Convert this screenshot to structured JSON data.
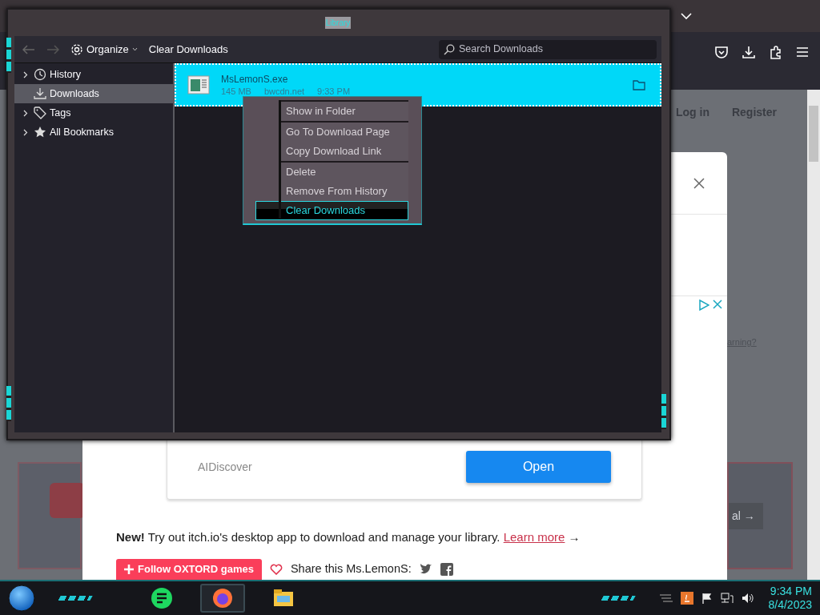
{
  "browser": {
    "nav_links": [
      "Log in",
      "Register"
    ]
  },
  "page": {
    "cut_link": "arning?",
    "side_button": "al →",
    "modal": {
      "ad_brand": "AIDiscover",
      "ad_button": "Open"
    },
    "notice": "**New!** Try out itch.io's desktop app to download and manage your library.",
    "notice_link": "Learn more",
    "notice_arrow": "→",
    "follow_button": "Follow OXTORD games",
    "share_label": "Share this Ms.LemonS:"
  },
  "library": {
    "title": "Library",
    "toolbar": {
      "organize": "Organize",
      "clear": "Clear Downloads",
      "search": {
        "placeholder": "Search Downloads"
      }
    },
    "sidebar": [
      {
        "label": "History",
        "kind": "history",
        "expandable": true,
        "selected": false
      },
      {
        "label": "Downloads",
        "kind": "downloads",
        "expandable": false,
        "selected": true
      },
      {
        "label": "Tags",
        "kind": "tags",
        "expandable": true,
        "selected": false
      },
      {
        "label": "All Bookmarks",
        "kind": "bookmarks",
        "expandable": true,
        "selected": false
      }
    ],
    "downloads": [
      {
        "name": "MsLemonS.exe",
        "size": "145 MB",
        "source": "bwcdn.net",
        "time": "9:33 PM",
        "selected": true
      }
    ]
  },
  "context_menu": [
    [
      {
        "label": "Show in Folder",
        "selected": false
      }
    ],
    [
      {
        "label": "Go To Download Page",
        "selected": false
      },
      {
        "label": "Copy Download Link",
        "selected": false
      }
    ],
    [
      {
        "label": "Delete",
        "selected": false
      },
      {
        "label": "Remove From History",
        "selected": false
      },
      {
        "label": "Clear Downloads",
        "selected": true
      }
    ]
  ],
  "taskbar": {
    "apps": [
      {
        "kind": "notes",
        "selected": false
      },
      {
        "kind": "firefox",
        "selected": true
      },
      {
        "kind": "explorer",
        "selected": false
      }
    ],
    "time": "9:34 PM",
    "date": "8/4/2023"
  }
}
